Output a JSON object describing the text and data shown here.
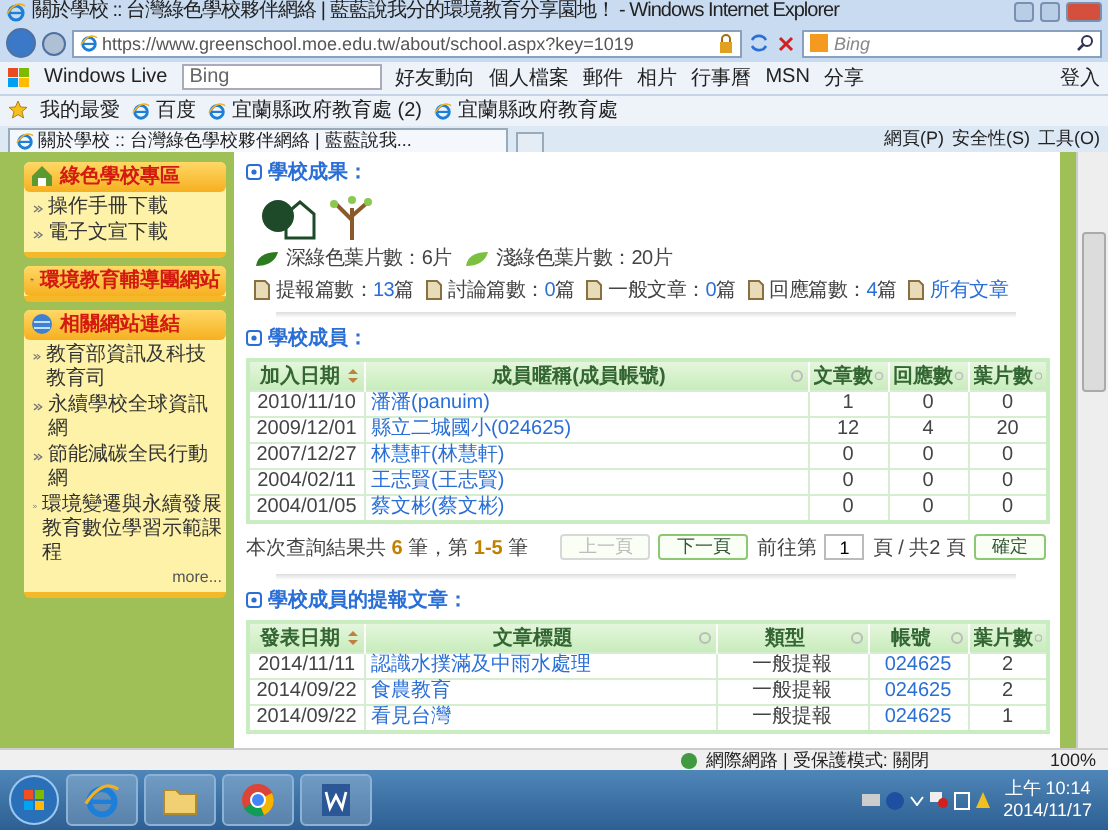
{
  "window": {
    "title": "關於學校 :: 台灣綠色學校夥伴網絡 | 藍藍說我分的環境教育分享園地！ - Windows Internet Explorer"
  },
  "address_bar": {
    "url": "https://www.greenschool.moe.edu.tw/about/school.aspx?key=1019",
    "search_placeholder": "Bing"
  },
  "live_toolbar": {
    "brand": "Windows Live",
    "search_value": "Bing",
    "links": [
      "好友動向",
      "個人檔案",
      "郵件",
      "相片",
      "行事曆",
      "MSN",
      "分享"
    ],
    "signin": "登入"
  },
  "favorites_bar": {
    "label": "我的最愛",
    "items": [
      "百度",
      "宜蘭縣政府教育處 (2)",
      "宜蘭縣政府教育處"
    ]
  },
  "tab": {
    "title": "關於學校 :: 台灣綠色學校夥伴網絡 | 藍藍說我...",
    "selected": true
  },
  "command_bar": [
    "網頁(P)",
    "安全性(S)",
    "工具(O)"
  ],
  "sidebar": [
    {
      "kind": "list",
      "title": "綠色學校專區",
      "items": [
        "操作手冊下載",
        "電子文宣下載"
      ]
    },
    {
      "kind": "link",
      "title": "環境教育輔導團網站"
    },
    {
      "kind": "list",
      "title": "相關網站連結",
      "items": [
        "教育部資訊及科技教育司",
        "永續學校全球資訊網",
        "節能減碳全民行動網",
        "環境變遷與永續發展教育數位學習示範課程"
      ],
      "more": "more..."
    }
  ],
  "achievements": {
    "heading": "學校成果：",
    "leaves": [
      "深綠色葉片數：6片",
      "淺綠色葉片數：20片"
    ],
    "stats": [
      {
        "label": "提報篇數：",
        "value": "13",
        "unit": "篇"
      },
      {
        "label": "討論篇數：",
        "value": "0",
        "unit": "篇"
      },
      {
        "label": "一般文章：",
        "value": "0",
        "unit": "篇"
      },
      {
        "label": "回應篇數：",
        "value": "4",
        "unit": "篇"
      }
    ],
    "all_link": "所有文章"
  },
  "members": {
    "heading": "學校成員：",
    "columns": [
      "加入日期",
      "成員暱稱(成員帳號)",
      "文章數",
      "回應數",
      "葉片數"
    ],
    "rows": [
      [
        "2010/11/10",
        "潘潘(panuim)",
        "1",
        "0",
        "0"
      ],
      [
        "2009/12/01",
        "縣立二城國小(024625)",
        "12",
        "4",
        "20"
      ],
      [
        "2007/12/27",
        "林慧軒(林慧軒)",
        "0",
        "0",
        "0"
      ],
      [
        "2004/02/11",
        "王志賢(王志賢)",
        "0",
        "0",
        "0"
      ],
      [
        "2004/01/05",
        "蔡文彬(蔡文彬)",
        "0",
        "0",
        "0"
      ]
    ],
    "summary": "本次查詢結果共 **6** 筆，第 **1-5** 筆",
    "pager": {
      "prev": {
        "label": "上一頁",
        "disabled": true
      },
      "next": {
        "label": "下一頁",
        "disabled": false
      },
      "goto_label": "前往第",
      "page": "1",
      "total": "頁 / 共2 頁",
      "confirm": "確定"
    }
  },
  "articles": {
    "heading": "學校成員的提報文章：",
    "columns": [
      "發表日期",
      "文章標題",
      "類型",
      "帳號",
      "葉片數"
    ],
    "rows": [
      [
        "2014/11/11",
        "認識水撲滿及中雨水處理",
        "一般提報",
        "024625",
        "2"
      ],
      [
        "2014/09/22",
        "食農教育",
        "一般提報",
        "024625",
        "2"
      ],
      [
        "2014/09/22",
        "看見台灣",
        "一般提報",
        "024625",
        "1"
      ]
    ]
  },
  "status_bar": {
    "zone": "網際網路 | 受保護模式: 關閉",
    "zoom": "100%"
  },
  "taskbar": {
    "time": "上午 10:14",
    "date": "2014/11/17"
  }
}
